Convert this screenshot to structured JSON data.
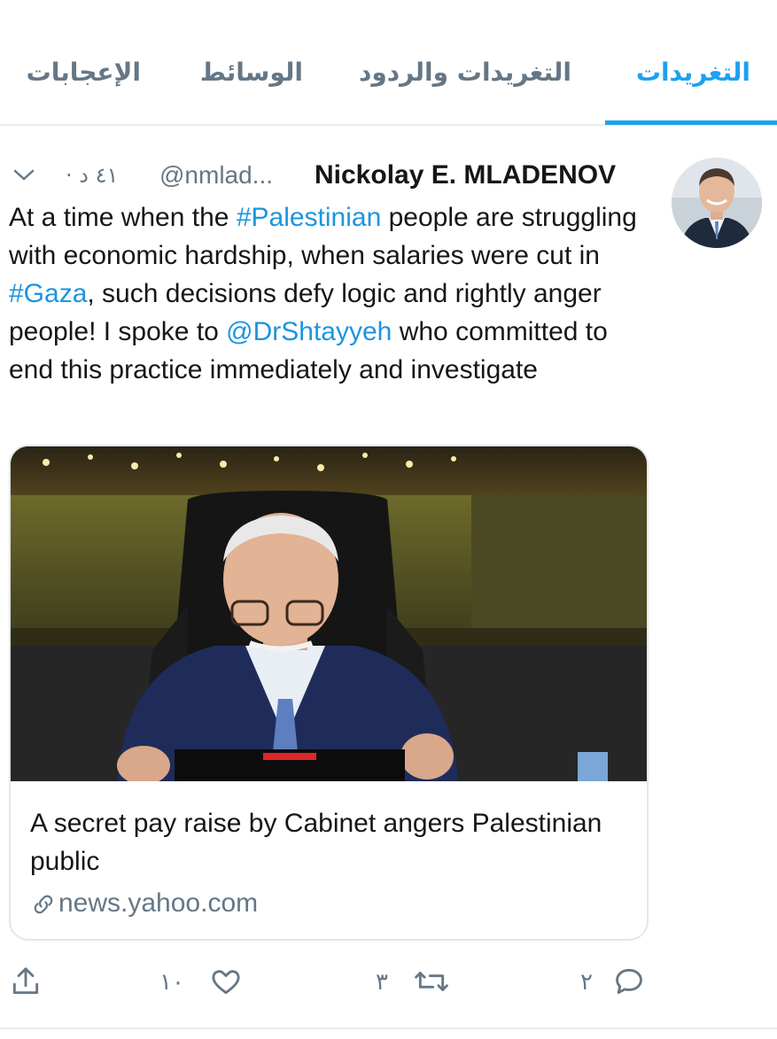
{
  "tabs": {
    "items": [
      {
        "label": "التغريدات",
        "active": true
      },
      {
        "label": "التغريدات والردود",
        "active": false
      },
      {
        "label": "الوسائط",
        "active": false
      },
      {
        "label": "الإعجابات",
        "active": false
      }
    ]
  },
  "tweet": {
    "author_name": "Nickolay E. MLADENOV",
    "author_handle": "@nmlad...",
    "time": "٤١ د ·",
    "text_parts": [
      {
        "text": "At a time when the ",
        "link": false
      },
      {
        "text": "#Palestinian",
        "link": true
      },
      {
        "text": " people are struggling with economic hardship, when salaries were cut in ",
        "link": false
      },
      {
        "text": "#Gaza",
        "link": true
      },
      {
        "text": ", such decisions defy logic and rightly anger people! I spoke to ",
        "link": false
      },
      {
        "text": "@DrShtayyeh",
        "link": true
      },
      {
        "text": " who committed to end this practice immediately and investigate",
        "link": false
      }
    ],
    "card": {
      "title": "A secret pay raise by Cabinet angers Palestinian public",
      "domain": "news.yahoo.com"
    },
    "actions": {
      "reply_count": "٢",
      "retweet_count": "٣",
      "like_count": "١٠"
    }
  },
  "colors": {
    "accent": "#1da1f2",
    "link": "#1b95e0",
    "muted": "#657786",
    "text": "#14171a",
    "border": "#e1e8ed"
  },
  "icons": [
    "chevron-down-icon",
    "link-icon",
    "reply-icon",
    "retweet-icon",
    "like-icon",
    "share-icon"
  ]
}
